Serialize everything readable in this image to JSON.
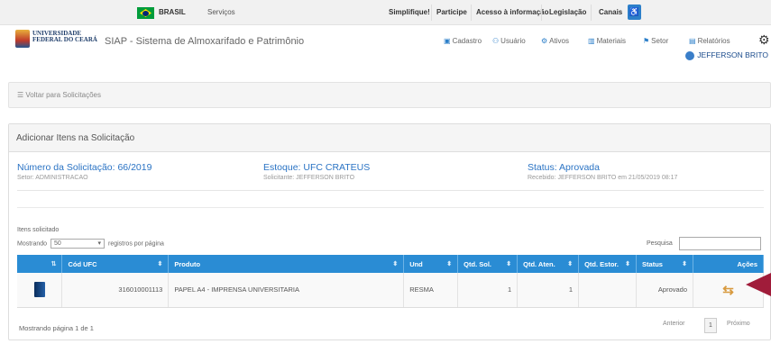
{
  "gov_bar": {
    "brasil": "BRASIL",
    "servicos": "Serviços",
    "links": [
      "Simplifique!",
      "Participe",
      "Acesso à informação",
      "Legislação",
      "Canais"
    ]
  },
  "app": {
    "logo_line1": "UNIVERSIDADE",
    "logo_line2": "FEDERAL DO CEARÁ",
    "title": "SIAP - Sistema de Almoxarifado e Patrimônio",
    "nav": [
      "Cadastro",
      "Usuário",
      "Ativos",
      "Materiais",
      "Setor",
      "Relatórios"
    ]
  },
  "user": {
    "name": "JEFFERSON BRITO"
  },
  "back_link": "Voltar para Solicitações",
  "panel": {
    "title": "Adicionar Itens na Solicitação",
    "request_number": "Número da Solicitação: 66/2019",
    "sector": "Setor: ADMINISTRACAO",
    "stock": "Estoque: UFC CRATEUS",
    "requester": "Solicitante: JEFFERSON BRITO",
    "status": "Status: Aprovada",
    "received": "Recebido: JEFFERSON BRITO em 21/05/2019 08:17"
  },
  "table_section": {
    "caption": "Itens solicitado",
    "show_label": "Mostrando",
    "page_size": "50",
    "per_page_label": "registros por página",
    "search_label": "Pesquisa"
  },
  "table": {
    "headers": [
      "",
      "Cód UFC",
      "Produto",
      "Und",
      "Qtd. Sol.",
      "Qtd. Aten.",
      "Qtd. Estor.",
      "Status",
      "Ações"
    ],
    "rows": [
      {
        "code": "316010001113",
        "product": "PAPEL A4 - IMPRENSA UNIVERSITARIA",
        "unit": "RESMA",
        "qty_sol": "1",
        "qty_aten": "1",
        "qty_estor": "",
        "status": "Aprovado"
      }
    ]
  },
  "footer": {
    "showing": "Mostrando página 1 de 1",
    "prev": "Anterior",
    "page": "1",
    "next": "Próximo"
  },
  "colors": {
    "header_blue": "#2a8cd4",
    "link_blue": "#2a73c4",
    "pointer": "#a01c3a",
    "action": "#d89a3f"
  }
}
